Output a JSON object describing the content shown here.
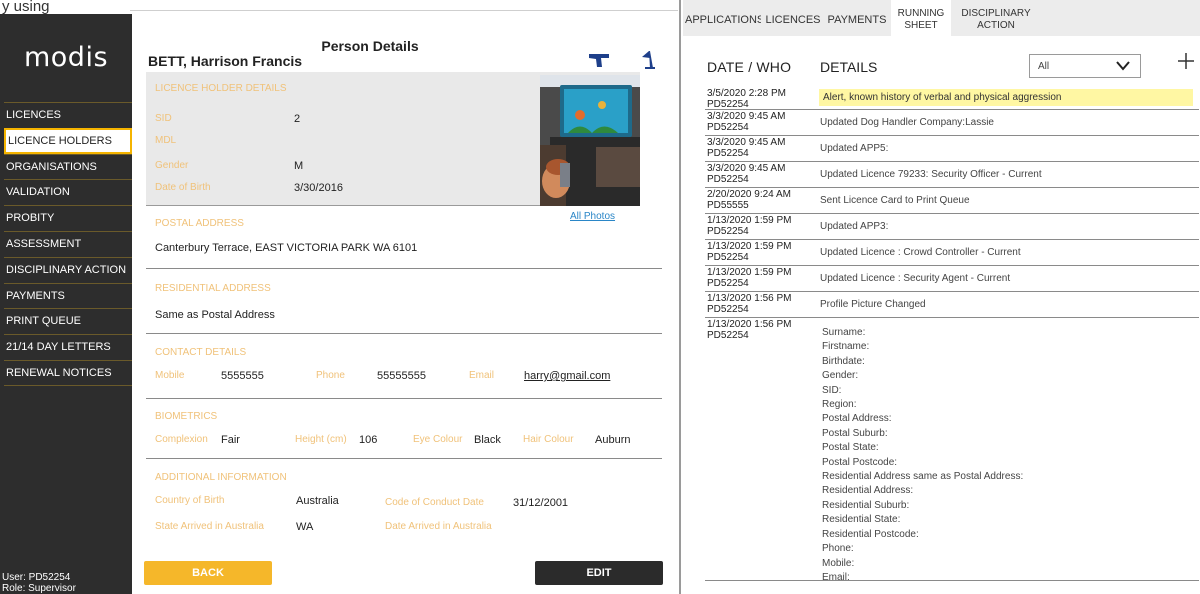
{
  "top_cropped_text": "y using",
  "app": {
    "logo": "modis"
  },
  "sidebar": {
    "items": [
      {
        "label": "LICENCES"
      },
      {
        "label": "LICENCE HOLDERS",
        "active": true
      },
      {
        "label": "ORGANISATIONS"
      },
      {
        "label": "VALIDATION"
      },
      {
        "label": "PROBITY"
      },
      {
        "label": "ASSESSMENT"
      },
      {
        "label": "DISCIPLINARY ACTION"
      },
      {
        "label": "PAYMENTS"
      },
      {
        "label": "PRINT QUEUE"
      },
      {
        "label": "21/14 DAY LETTERS"
      },
      {
        "label": "RENEWAL NOTICES"
      }
    ],
    "user_line": "User: PD52254",
    "role_line": "Role: Supervisor"
  },
  "person": {
    "panel_title": "Person Details",
    "name": "BETT, Harrison Francis",
    "icons": [
      "gun-icon",
      "flag-icon"
    ],
    "licence_holder": {
      "section": "LICENCE HOLDER DETAILS",
      "sid_label": "SID",
      "sid": "2",
      "mdl_label": "MDL",
      "mdl": "",
      "gender_label": "Gender",
      "gender": "M",
      "dob_label": "Date of Birth",
      "dob": "3/30/2016"
    },
    "all_photos": "All Photos",
    "postal": {
      "section": "POSTAL ADDRESS",
      "value": "Canterbury Terrace, EAST VICTORIA PARK WA 6101"
    },
    "residential": {
      "section": "RESIDENTIAL ADDRESS",
      "value": "Same as Postal Address"
    },
    "contact": {
      "section": "CONTACT DETAILS",
      "mobile_label": "Mobile",
      "mobile": "5555555",
      "phone_label": "Phone",
      "phone": "55555555",
      "email_label": "Email",
      "email": "harry@gmail.com"
    },
    "biometrics": {
      "section": "BIOMETRICS",
      "complexion_label": "Complexion",
      "complexion": "Fair",
      "height_label": "Height (cm)",
      "height": "106",
      "eye_label": "Eye Colour",
      "eye": "Black",
      "hair_label": "Hair Colour",
      "hair": "Auburn"
    },
    "additional": {
      "section": "ADDITIONAL INFORMATION",
      "cob_label": "Country of Birth",
      "cob": "Australia",
      "coc_label": "Code of Conduct Date",
      "coc": "31/12/2001",
      "state_label": "State Arrived in Australia",
      "state": "WA",
      "date_arrived_label": "Date Arrived in Australia",
      "date_arrived": ""
    },
    "back_label": "BACK",
    "edit_label": "EDIT"
  },
  "tabs": [
    {
      "label": "APPLICATIONS"
    },
    {
      "label": "LICENCES"
    },
    {
      "label": "PAYMENTS"
    },
    {
      "label": "RUNNING\nSHEET",
      "active": true
    },
    {
      "label": "DISCIPLINARY\nACTION"
    }
  ],
  "running_sheet": {
    "col_date": "DATE / WHO",
    "col_details": "DETAILS",
    "filter_value": "All",
    "entries": [
      {
        "date": "3/5/2020 2:28 PM",
        "who": "PD52254",
        "details": "Alert, known history of verbal and physical aggression",
        "alert": true
      },
      {
        "date": "3/3/2020 9:45 AM",
        "who": "PD52254",
        "details": "Updated Dog Handler Company:Lassie"
      },
      {
        "date": "3/3/2020 9:45 AM",
        "who": "PD52254",
        "details": "Updated APP5:"
      },
      {
        "date": "3/3/2020 9:45 AM",
        "who": "PD52254",
        "details": "Updated Licence 79233: Security Officer - Current"
      },
      {
        "date": "2/20/2020 9:24 AM",
        "who": "PD55555",
        "details": "Sent Licence Card  to Print Queue"
      },
      {
        "date": "1/13/2020 1:59 PM",
        "who": "PD52254",
        "details": "Updated APP3:"
      },
      {
        "date": "1/13/2020 1:59 PM",
        "who": "PD52254",
        "details": "Updated Licence : Crowd Controller - Current"
      },
      {
        "date": "1/13/2020 1:59 PM",
        "who": "PD52254",
        "details": "Updated Licence : Security Agent - Current"
      },
      {
        "date": "1/13/2020 1:56 PM",
        "who": "PD52254",
        "details": "Profile Picture Changed"
      },
      {
        "date": "1/13/2020 1:56 PM",
        "who": "PD52254",
        "details": ""
      }
    ],
    "profile_fields": [
      "Surname:",
      "Firstname:",
      "Birthdate:",
      "Gender:",
      "SID:",
      "Region:",
      "Postal Address:",
      "Postal Suburb:",
      "Postal State:",
      "Postal Postcode:",
      "Residential Address same as Postal Address:",
      "Residential Address:",
      "Residential Suburb:",
      "Residential State:",
      "Residential Postcode:",
      "Phone:",
      "Mobile:",
      "Email:"
    ]
  },
  "colors": {
    "accent": "#f5b72a",
    "sidebar": "#2d2d2d",
    "label_gold": "#f0c27a",
    "link": "#2a86c7",
    "alert_bg": "#fff7a3"
  }
}
